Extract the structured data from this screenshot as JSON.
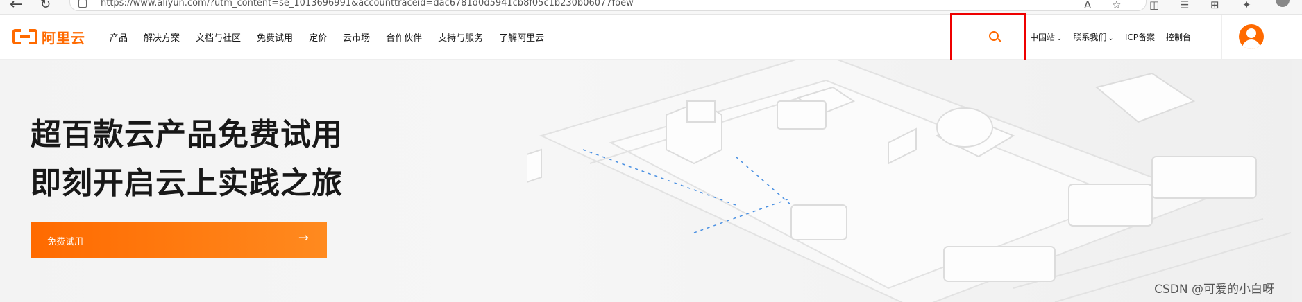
{
  "browser": {
    "url": "https://www.aliyun.com/?utm_content=se_1013696991&accounttraceid=dac6781d0d5941cb8f05c1b230b06077foew",
    "back_icon": "arrow-left-icon",
    "reload_icon": "reload-icon"
  },
  "header": {
    "logo_text": "阿里云",
    "nav": [
      "产品",
      "解决方案",
      "文档与社区",
      "免费试用",
      "定价",
      "云市场",
      "合作伙伴",
      "支持与服务",
      "了解阿里云"
    ],
    "search_icon": "search-icon",
    "right_menu": {
      "region": "中国站",
      "contact": "联系我们",
      "icp": "ICP备案",
      "console": "控制台"
    },
    "avatar_icon": "user-avatar-icon"
  },
  "hero": {
    "title_line1": "超百款云产品免费试用",
    "title_line2": "即刻开启云上实践之旅",
    "cta_label": "免费试用",
    "cta_arrow": "→"
  },
  "watermark": "CSDN @可爱的小白呀",
  "colors": {
    "brand": "#ff6a00",
    "highlight_border": "#e00000"
  }
}
